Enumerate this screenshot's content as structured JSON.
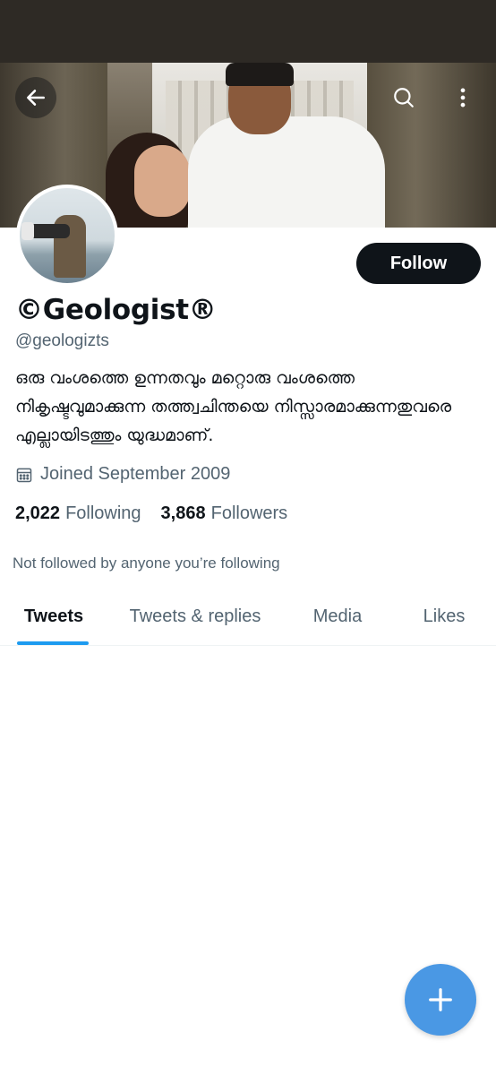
{
  "colors": {
    "accent": "#1d9bf0",
    "fab": "#4a98e4",
    "text_primary": "#0f1419",
    "text_secondary": "#536471",
    "follow_button_bg": "#0f1419",
    "status_bar": "#2e2a25"
  },
  "header": {
    "back_icon": "arrow-left-icon",
    "search_icon": "search-icon",
    "more_icon": "more-vertical-icon"
  },
  "profile": {
    "display_name": "©Geologist®",
    "handle": "@geologizts",
    "bio": "ഒരു വംശത്തെ ഉന്നതവും മറ്റൊരു വംശത്തെ നികൃഷ്ടവുമാക്കുന്ന തത്ത്വചിന്തയെ നിസ്സാരമാക്കുന്നതുവരെ എല്ലായിടത്തും യുദ്ധമാണ്.",
    "joined": "Joined September 2009",
    "joined_icon": "calendar-icon",
    "following_count": "2,022",
    "following_label": "Following",
    "followers_count": "3,868",
    "followers_label": "Followers",
    "not_followed_text": "Not followed by anyone you’re following"
  },
  "actions": {
    "follow_label": "Follow"
  },
  "tabs": [
    {
      "label": "Tweets",
      "active": true
    },
    {
      "label": "Tweets & replies",
      "active": false
    },
    {
      "label": "Media",
      "active": false
    },
    {
      "label": "Likes",
      "active": false
    }
  ],
  "fab": {
    "icon": "plus-icon"
  }
}
